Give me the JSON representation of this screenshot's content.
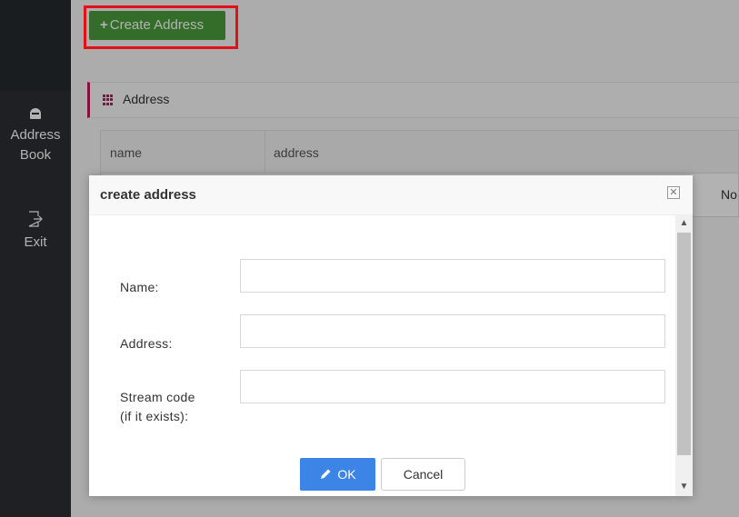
{
  "sidebar": {
    "items": [
      {
        "label": "Address Book",
        "icon": "address-book-icon"
      },
      {
        "label": "Exit",
        "icon": "exit-icon"
      }
    ]
  },
  "toolbar": {
    "create_label": "Create Address",
    "create_icon": "plus-icon"
  },
  "panel": {
    "title": "Address",
    "icon": "grid-icon"
  },
  "table": {
    "columns": [
      "name",
      "address"
    ],
    "rows": [
      {
        "trailing_text": "No"
      }
    ]
  },
  "modal": {
    "title": "create address",
    "fields": [
      {
        "label": "Name:",
        "value": ""
      },
      {
        "label": "Address:",
        "value": ""
      },
      {
        "label": "Stream code (if it exists):",
        "value": ""
      }
    ],
    "ok_label": "OK",
    "cancel_label": "Cancel"
  },
  "colors": {
    "sidebar_bg": "#2b2f33",
    "create_button": "#4a9c3b",
    "highlight_box": "#e3101a",
    "panel_accent": "#c2185b",
    "ok_button": "#3c84e6"
  }
}
